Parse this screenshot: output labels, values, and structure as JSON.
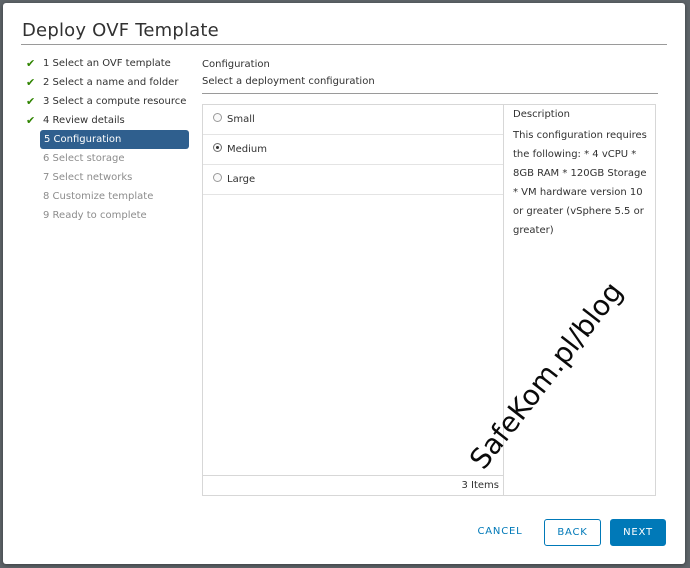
{
  "dialog": {
    "title": "Deploy OVF Template"
  },
  "steps": [
    {
      "label": "1 Select an OVF template",
      "state": "done"
    },
    {
      "label": "2 Select a name and folder",
      "state": "done"
    },
    {
      "label": "3 Select a compute resource",
      "state": "done"
    },
    {
      "label": "4 Review details",
      "state": "done"
    },
    {
      "label": "5 Configuration",
      "state": "active"
    },
    {
      "label": "6 Select storage",
      "state": "pending"
    },
    {
      "label": "7 Select networks",
      "state": "pending"
    },
    {
      "label": "8 Customize template",
      "state": "pending"
    },
    {
      "label": "9 Ready to complete",
      "state": "pending"
    }
  ],
  "section": {
    "title": "Configuration",
    "subtitle": "Select a deployment configuration"
  },
  "options": [
    {
      "label": "Small",
      "selected": false
    },
    {
      "label": "Medium",
      "selected": true
    },
    {
      "label": "Large",
      "selected": false
    }
  ],
  "item_count": "3 Items",
  "description": {
    "title": "Description",
    "text": "This configuration requires the following: * 4 vCPU * 8GB RAM * 120GB Storage * VM hardware version 10 or greater (vSphere 5.5 or greater)"
  },
  "buttons": {
    "cancel": "CANCEL",
    "back": "BACK",
    "next": "NEXT"
  },
  "watermark": "SafeKom.pl/blog",
  "colors": {
    "accent": "#0079b8",
    "active_step": "#2f5f8e",
    "check": "#2f8400"
  },
  "icons": {
    "step_done": "check-icon"
  }
}
